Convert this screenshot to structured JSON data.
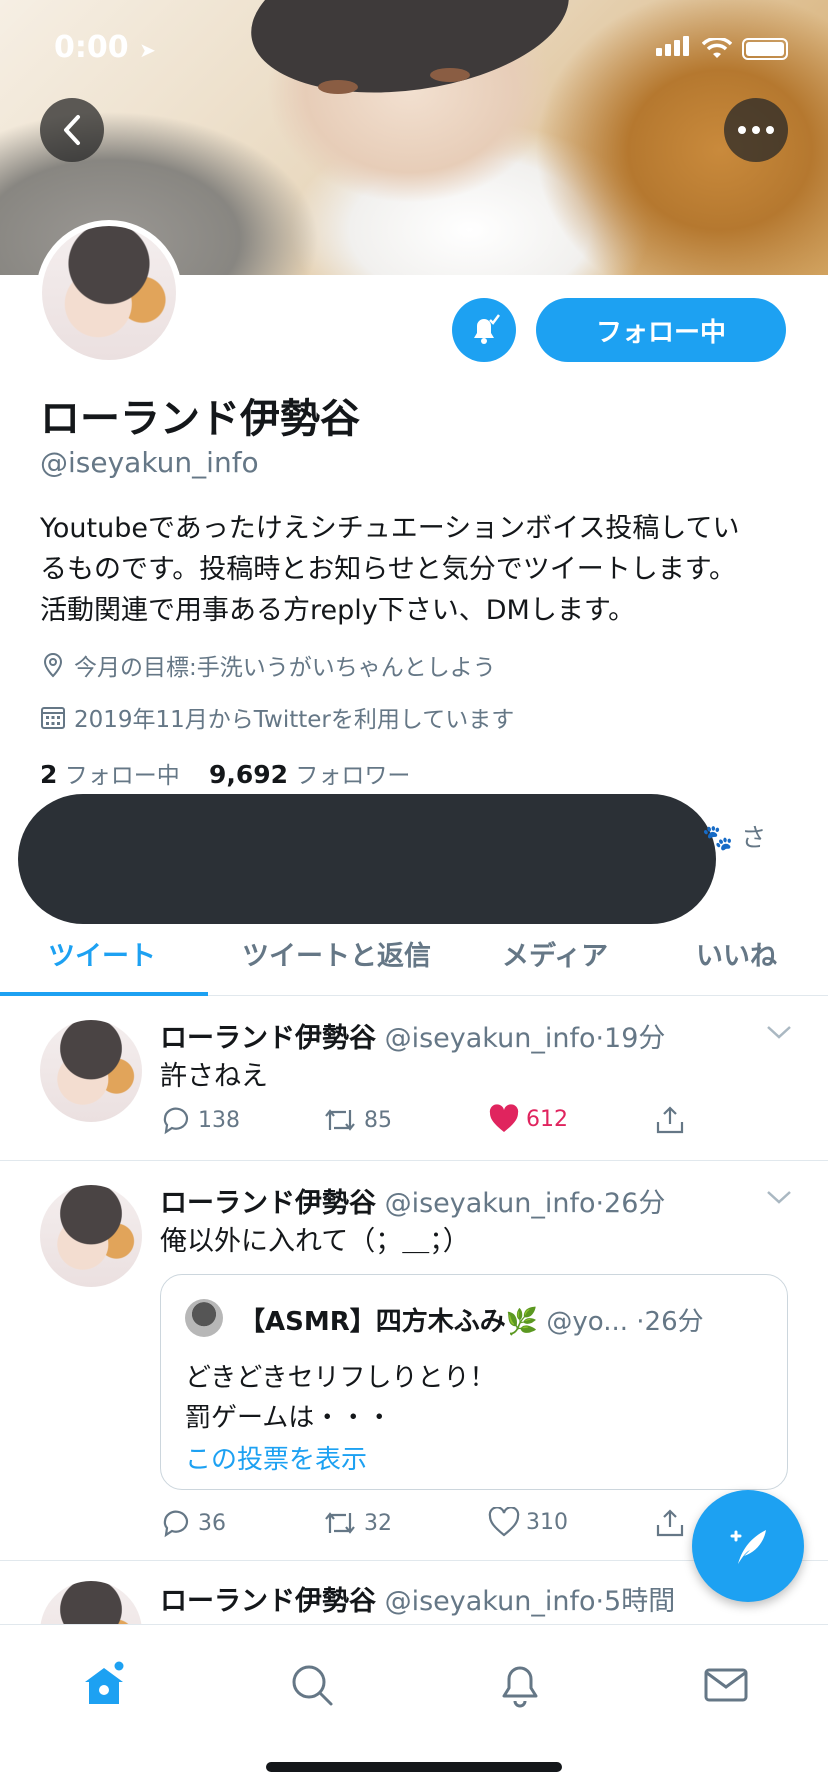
{
  "status_bar": {
    "time": "0:00"
  },
  "header": {
    "back_icon": "back-chevron-icon",
    "more_icon": "more-dots-icon"
  },
  "profile": {
    "name": "ローランド伊勢谷",
    "handle": "@iseyakun_info",
    "bio_lines": [
      "Youtubeであったけえシチュエーションボイス投稿してい",
      "るものです。投稿時とお知らせと気分でツイートします。",
      "活動関連で用事ある方reply下さい、DMします。"
    ],
    "location": "今月の目標:手洗いうがいちゃんとしよう",
    "joined": "2019年11月からTwitterを利用しています",
    "following_count": "2",
    "following_label": "フォロー中",
    "followers_count": "9,692",
    "followers_label": "フォロワー",
    "follow_button": "フォロー中",
    "trailing_text": "さ"
  },
  "tabs": [
    "ツイート",
    "ツイートと返信",
    "メディア",
    "いいね"
  ],
  "tweets": [
    {
      "name": "ローランド伊勢谷",
      "handle": "@iseyakun_info",
      "time": "·19分",
      "text": "許さねえ",
      "replies": "138",
      "retweets": "85",
      "likes": "612"
    },
    {
      "name": "ローランド伊勢谷",
      "handle": "@iseyakun_info",
      "time": "·26分",
      "text": "俺以外に入れて（；＿；）",
      "quote": {
        "name": "【ASMR】四方木ふみ🌿",
        "handle": "@yo...",
        "time": "·26分",
        "line1": "どきどきセリフしりとり！",
        "line2": "罰ゲームは・・・",
        "link": "この投票を表示"
      },
      "replies": "36",
      "retweets": "32",
      "likes": "310"
    },
    {
      "name": "ローランド伊勢谷",
      "handle": "@iseyakun_info",
      "time": "·5時間"
    }
  ],
  "colors": {
    "accent": "#1da1f2",
    "like": "#e0245e",
    "secondary_text": "#657786"
  }
}
